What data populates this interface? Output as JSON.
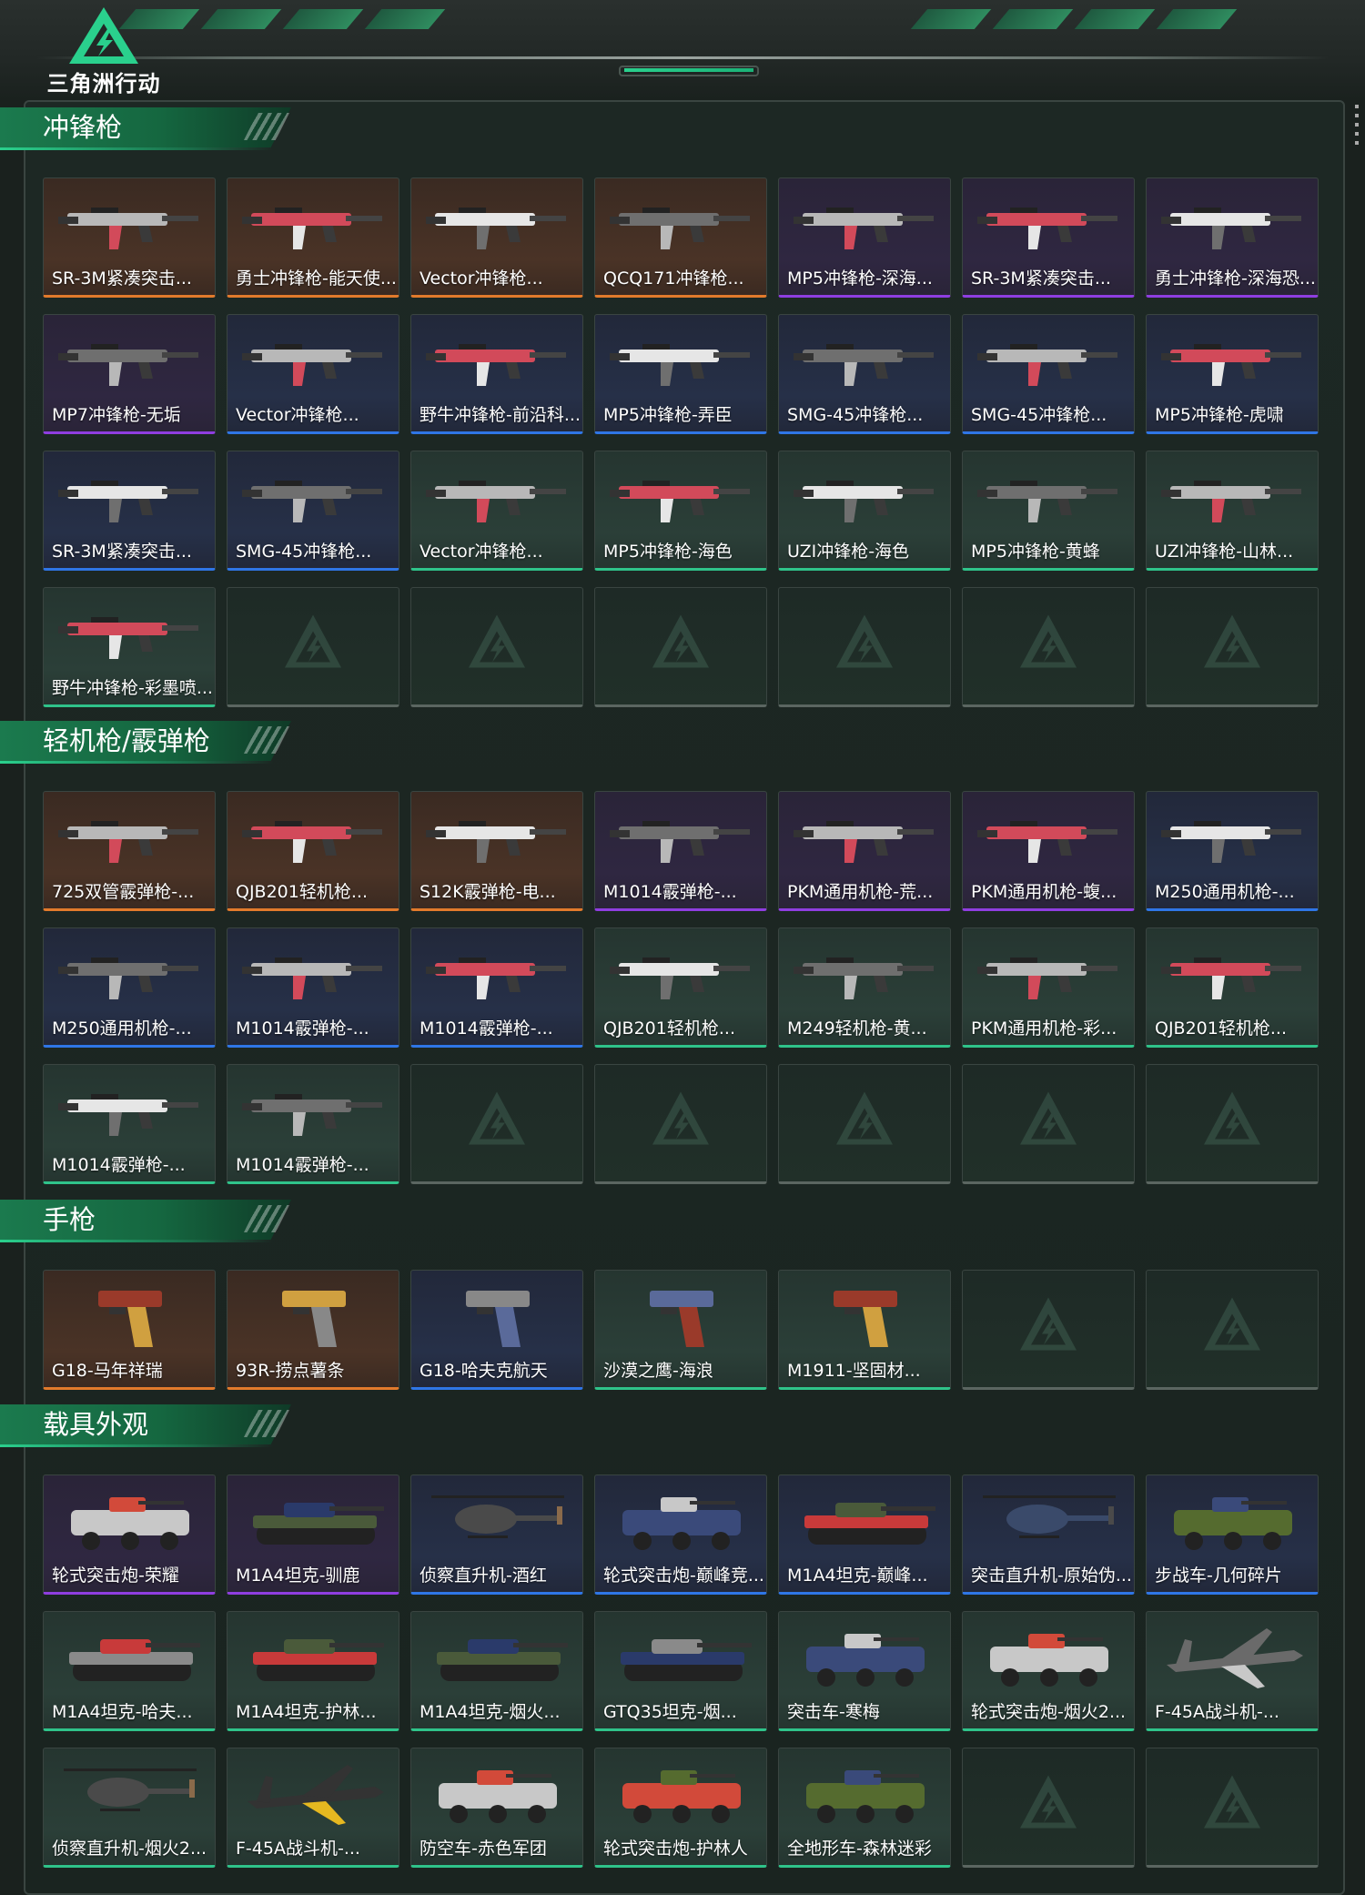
{
  "app": {
    "logo_text": "三角洲行动",
    "header_progress": 1.0
  },
  "colors": {
    "accent": "#2ad08d",
    "rarity_orange": "#e27a2c",
    "rarity_purple": "#8f3ee0",
    "rarity_blue": "#2f76e6",
    "rarity_green": "#2fc38a",
    "empty": "#5b6661"
  },
  "sections": [
    {
      "title": "冲锋枪",
      "items": [
        {
          "name": "SR-3M紧凑突击...",
          "rarity": "orange",
          "art": "gun"
        },
        {
          "name": "勇士冲锋枪-能天使...",
          "rarity": "orange",
          "art": "gun"
        },
        {
          "name": "Vector冲锋枪...",
          "rarity": "orange",
          "art": "gun"
        },
        {
          "name": "QCQ171冲锋枪...",
          "rarity": "orange",
          "art": "gun"
        },
        {
          "name": "MP5冲锋枪-深海...",
          "rarity": "purple",
          "art": "gun"
        },
        {
          "name": "SR-3M紧凑突击...",
          "rarity": "purple",
          "art": "gun"
        },
        {
          "name": "勇士冲锋枪-深海恐...",
          "rarity": "purple",
          "art": "gun"
        },
        {
          "name": "MP7冲锋枪-无垢",
          "rarity": "purple",
          "art": "gun"
        },
        {
          "name": "Vector冲锋枪...",
          "rarity": "blue",
          "art": "gun"
        },
        {
          "name": "野牛冲锋枪-前沿科...",
          "rarity": "blue",
          "art": "gun"
        },
        {
          "name": "MP5冲锋枪-弄臣",
          "rarity": "blue",
          "art": "gun"
        },
        {
          "name": "SMG-45冲锋枪...",
          "rarity": "blue",
          "art": "gun"
        },
        {
          "name": "SMG-45冲锋枪...",
          "rarity": "blue",
          "art": "gun"
        },
        {
          "name": "MP5冲锋枪-虎啸",
          "rarity": "blue",
          "art": "gun"
        },
        {
          "name": "SR-3M紧凑突击...",
          "rarity": "blue",
          "art": "gun"
        },
        {
          "name": "SMG-45冲锋枪...",
          "rarity": "blue",
          "art": "gun"
        },
        {
          "name": "Vector冲锋枪...",
          "rarity": "green",
          "art": "gun"
        },
        {
          "name": "MP5冲锋枪-海色",
          "rarity": "green",
          "art": "gun"
        },
        {
          "name": "UZI冲锋枪-海色",
          "rarity": "green",
          "art": "gun"
        },
        {
          "name": "MP5冲锋枪-黄蜂",
          "rarity": "green",
          "art": "gun"
        },
        {
          "name": "UZI冲锋枪-山林...",
          "rarity": "green",
          "art": "gun"
        },
        {
          "name": "野牛冲锋枪-彩墨喷...",
          "rarity": "green",
          "art": "gun"
        },
        {
          "name": "",
          "rarity": "empty",
          "art": "none"
        },
        {
          "name": "",
          "rarity": "empty",
          "art": "none"
        },
        {
          "name": "",
          "rarity": "empty",
          "art": "none"
        },
        {
          "name": "",
          "rarity": "empty",
          "art": "none"
        },
        {
          "name": "",
          "rarity": "empty",
          "art": "none"
        },
        {
          "name": "",
          "rarity": "empty",
          "art": "none"
        }
      ]
    },
    {
      "title": "轻机枪/霰弹枪",
      "items": [
        {
          "name": "725双管霰弹枪-...",
          "rarity": "orange",
          "art": "gun"
        },
        {
          "name": "QJB201轻机枪...",
          "rarity": "orange",
          "art": "gun"
        },
        {
          "name": "S12K霰弹枪-电...",
          "rarity": "orange",
          "art": "gun"
        },
        {
          "name": "M1014霰弹枪-...",
          "rarity": "purple",
          "art": "gun"
        },
        {
          "name": "PKM通用机枪-荒...",
          "rarity": "purple",
          "art": "gun"
        },
        {
          "name": "PKM通用机枪-蝮...",
          "rarity": "purple",
          "art": "gun"
        },
        {
          "name": "M250通用机枪-...",
          "rarity": "blue",
          "art": "gun"
        },
        {
          "name": "M250通用机枪-...",
          "rarity": "blue",
          "art": "gun"
        },
        {
          "name": "M1014霰弹枪-...",
          "rarity": "blue",
          "art": "gun"
        },
        {
          "name": "M1014霰弹枪-...",
          "rarity": "blue",
          "art": "gun"
        },
        {
          "name": "QJB201轻机枪...",
          "rarity": "green",
          "art": "gun"
        },
        {
          "name": "M249轻机枪-黄...",
          "rarity": "green",
          "art": "gun"
        },
        {
          "name": "PKM通用机枪-彩...",
          "rarity": "green",
          "art": "gun"
        },
        {
          "name": "QJB201轻机枪...",
          "rarity": "green",
          "art": "gun"
        },
        {
          "name": "M1014霰弹枪-...",
          "rarity": "green",
          "art": "gun"
        },
        {
          "name": "M1014霰弹枪-...",
          "rarity": "green",
          "art": "gun"
        },
        {
          "name": "",
          "rarity": "empty",
          "art": "none"
        },
        {
          "name": "",
          "rarity": "empty",
          "art": "none"
        },
        {
          "name": "",
          "rarity": "empty",
          "art": "none"
        },
        {
          "name": "",
          "rarity": "empty",
          "art": "none"
        },
        {
          "name": "",
          "rarity": "empty",
          "art": "none"
        }
      ]
    },
    {
      "title": "手枪",
      "items": [
        {
          "name": "G18-马年祥瑞",
          "rarity": "orange",
          "art": "pistol"
        },
        {
          "name": "93R-捞点薯条",
          "rarity": "orange",
          "art": "pistol"
        },
        {
          "name": "G18-哈夫克航天",
          "rarity": "blue",
          "art": "pistol"
        },
        {
          "name": "沙漠之鹰-海浪",
          "rarity": "green",
          "art": "pistol"
        },
        {
          "name": "M1911-坚固材...",
          "rarity": "green",
          "art": "pistol"
        },
        {
          "name": "",
          "rarity": "empty",
          "art": "none"
        },
        {
          "name": "",
          "rarity": "empty",
          "art": "none"
        }
      ]
    },
    {
      "title": "载具外观",
      "items": [
        {
          "name": "轮式突击炮-荣耀",
          "rarity": "purple",
          "art": "vehicle"
        },
        {
          "name": "M1A4坦克-驯鹿",
          "rarity": "purple",
          "art": "tank"
        },
        {
          "name": "侦察直升机-酒红",
          "rarity": "blue",
          "art": "heli"
        },
        {
          "name": "轮式突击炮-巅峰竞...",
          "rarity": "blue",
          "art": "vehicle"
        },
        {
          "name": "M1A4坦克-巅峰...",
          "rarity": "blue",
          "art": "tank"
        },
        {
          "name": "突击直升机-原始伪...",
          "rarity": "blue",
          "art": "heli"
        },
        {
          "name": "步战车-几何碎片",
          "rarity": "blue",
          "art": "vehicle"
        },
        {
          "name": "M1A4坦克-哈夫...",
          "rarity": "green",
          "art": "tank"
        },
        {
          "name": "M1A4坦克-护林...",
          "rarity": "green",
          "art": "tank"
        },
        {
          "name": "M1A4坦克-烟火...",
          "rarity": "green",
          "art": "tank"
        },
        {
          "name": "GTQ35坦克-烟...",
          "rarity": "green",
          "art": "tank"
        },
        {
          "name": "突击车-寒梅",
          "rarity": "green",
          "art": "vehicle"
        },
        {
          "name": "轮式突击炮-烟火2...",
          "rarity": "green",
          "art": "vehicle"
        },
        {
          "name": "F-45A战斗机-...",
          "rarity": "green",
          "art": "jet"
        },
        {
          "name": "侦察直升机-烟火2...",
          "rarity": "green",
          "art": "heli"
        },
        {
          "name": "F-45A战斗机-...",
          "rarity": "green",
          "art": "jet"
        },
        {
          "name": "防空车-赤色军团",
          "rarity": "green",
          "art": "vehicle"
        },
        {
          "name": "轮式突击炮-护林人",
          "rarity": "green",
          "art": "vehicle"
        },
        {
          "name": "全地形车-森林迷彩",
          "rarity": "green",
          "art": "vehicle"
        },
        {
          "name": "",
          "rarity": "empty",
          "art": "none"
        },
        {
          "name": "",
          "rarity": "empty",
          "art": "none"
        }
      ]
    }
  ]
}
